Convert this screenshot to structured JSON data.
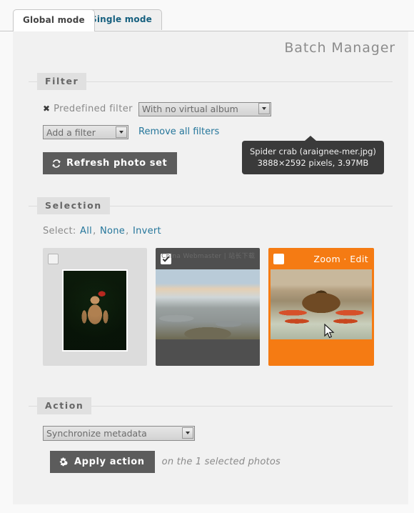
{
  "tabs": [
    {
      "label": "Global mode",
      "active": true
    },
    {
      "label": "Single mode",
      "active": false
    }
  ],
  "page": {
    "title": "Batch Manager"
  },
  "filter": {
    "legend": "Filter",
    "remove_mark": "✖",
    "predefined_label": "Predefined filter",
    "predefined_value": "With no virtual album",
    "add_filter_value": "Add a filter",
    "remove_all_label": "Remove all filters",
    "refresh_label": "Refresh photo set",
    "refresh_icon": "refresh-icon"
  },
  "selection": {
    "legend": "Selection",
    "select_label": "Select:",
    "links": [
      "All",
      "None",
      "Invert"
    ],
    "separator": ", ",
    "thumbs": [
      {
        "name": "teddy-bear-christmas",
        "state": "normal",
        "checked": false,
        "watermark": ""
      },
      {
        "name": "stone-cairns-landscape",
        "state": "selected",
        "checked": true,
        "watermark": "China Webmaster | 站长下载"
      },
      {
        "name": "spider-crab",
        "state": "hovered",
        "checked": false,
        "watermark": "",
        "zoom_label": "Zoom",
        "action_separator": " · ",
        "edit_label": "Edit"
      }
    ],
    "tooltip": {
      "title": "Spider crab (araignee-mer.jpg)",
      "details": "3888×2592 pixels, 3.97MB"
    }
  },
  "action": {
    "legend": "Action",
    "selected_action": "Synchronize metadata",
    "apply_label": "Apply action",
    "apply_icon": "gears-icon",
    "apply_note": "on the 1 selected photos"
  },
  "colors": {
    "accent_orange": "#f57b13",
    "link_blue": "#25769b",
    "dark_button": "#5c5c5c",
    "selected_thumb": "#4f4f4f",
    "panel_bg": "#f1f1f1"
  }
}
